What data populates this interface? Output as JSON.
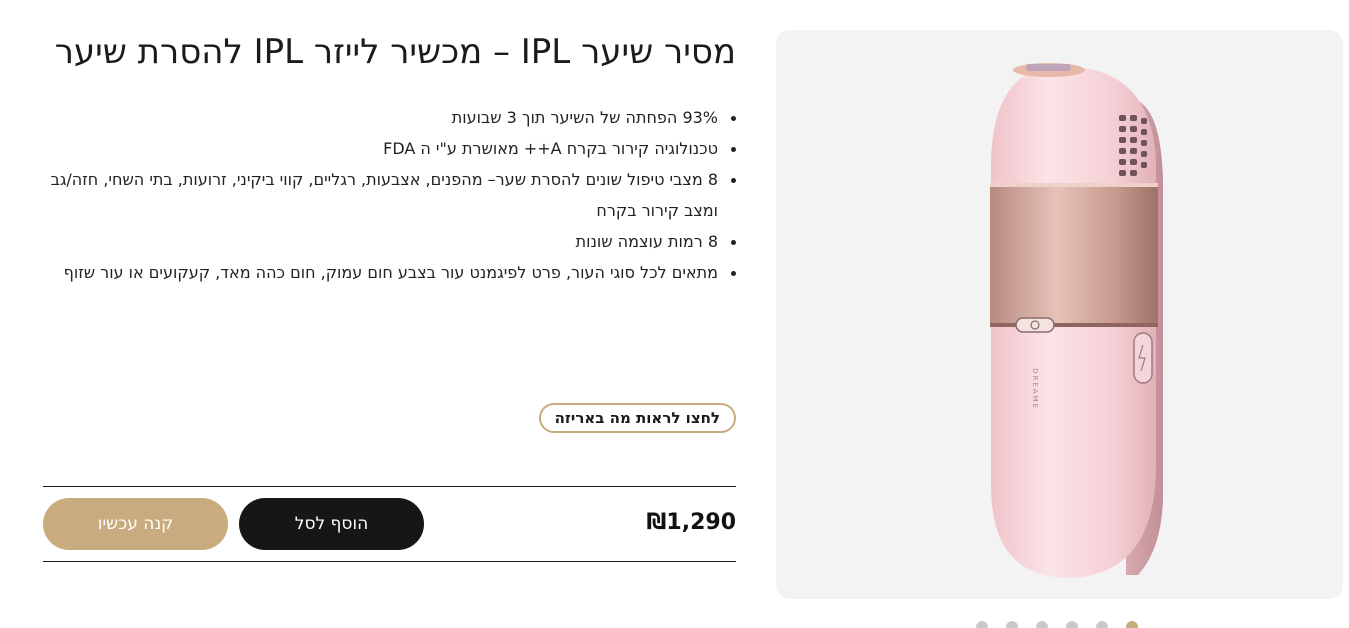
{
  "product": {
    "title": "מסיר שיער IPL – מכשיר לייזר IPL להסרת שיער",
    "features": [
      "93% הפחתה של השיער תוך 3 שבועות",
      "טכנולוגיה קירור בקרח A++ מאושרת ע\"י ה FDA",
      "8 מצבי טיפול שונים להסרת שער– מהפנים, אצבעות, רגליים, קווי ביקיני, זרועות, בתי השחי, חזה/גב ומצב קירור בקרח",
      "8 רמות עוצמה שונות",
      "מתאים לכל סוגי העור, פרט לפיגמנט עור בצבע חום עמוק, חום כהה מאד, קעקועים או עור שזוף"
    ],
    "whats_in_box_label": "לחצו לראות מה באריזה",
    "price": "₪1,290",
    "add_to_cart_label": "הוסף לסל",
    "buy_now_label": "קנה עכשיו",
    "device_brand_text": "DREAME"
  },
  "gallery": {
    "slide_count": 6,
    "active_index": 0
  },
  "colors": {
    "accent_gold": "#c8ab7e",
    "button_dark": "#161616",
    "device_pink": "#f3cfd4",
    "device_band": "#c79a8f",
    "gallery_bg": "#f3f3f3"
  }
}
